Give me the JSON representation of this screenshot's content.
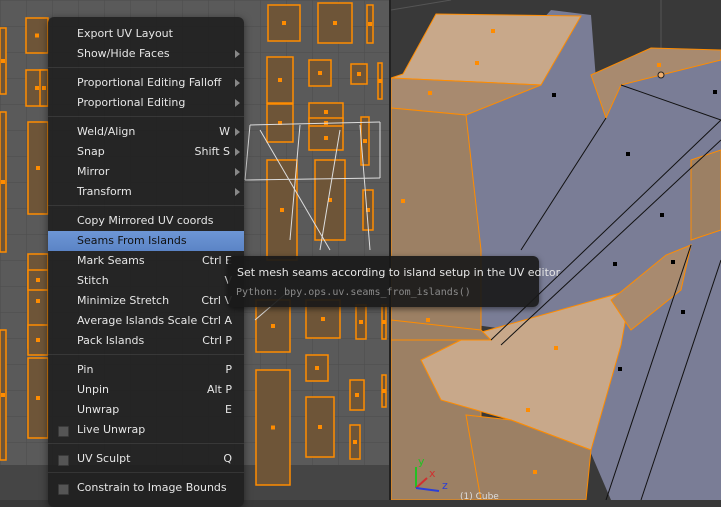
{
  "uv_menu": {
    "items": [
      {
        "label": "Export UV Layout",
        "shortcut": "",
        "submenu": false
      },
      {
        "label": "Show/Hide Faces",
        "shortcut": "",
        "submenu": true
      },
      {
        "label": "Proportional Editing Falloff",
        "shortcut": "",
        "submenu": true
      },
      {
        "label": "Proportional Editing",
        "shortcut": "",
        "submenu": true
      },
      {
        "label": "Weld/Align",
        "shortcut": "W",
        "submenu": true
      },
      {
        "label": "Snap",
        "shortcut": "Shift S",
        "submenu": true
      },
      {
        "label": "Mirror",
        "shortcut": "",
        "submenu": true
      },
      {
        "label": "Transform",
        "shortcut": "",
        "submenu": true
      },
      {
        "label": "Copy Mirrored UV coords",
        "shortcut": "",
        "submenu": false
      },
      {
        "label": "Seams From Islands",
        "shortcut": "",
        "submenu": false,
        "highlighted": true
      },
      {
        "label": "Mark Seams",
        "shortcut": "Ctrl E",
        "submenu": false
      },
      {
        "label": "Stitch",
        "shortcut": "V",
        "submenu": false
      },
      {
        "label": "Minimize Stretch",
        "shortcut": "Ctrl V",
        "submenu": false
      },
      {
        "label": "Average Islands Scale",
        "shortcut": "Ctrl A",
        "submenu": false
      },
      {
        "label": "Pack Islands",
        "shortcut": "Ctrl P",
        "submenu": false
      },
      {
        "label": "Pin",
        "shortcut": "P",
        "submenu": false
      },
      {
        "label": "Unpin",
        "shortcut": "Alt P",
        "submenu": false
      },
      {
        "label": "Unwrap",
        "shortcut": "E",
        "submenu": false
      },
      {
        "label": "Live Unwrap",
        "shortcut": "",
        "checkbox": true,
        "checked": false
      },
      {
        "label": "UV Sculpt",
        "shortcut": "Q",
        "checkbox": true,
        "checked": false
      },
      {
        "label": "Constrain to Image Bounds",
        "shortcut": "",
        "checkbox": true,
        "checked": false
      }
    ]
  },
  "tooltip": {
    "description": "Set mesh seams according to island setup in the UV editor",
    "python": "Python: bpy.ops.uv.seams_from_islands()"
  },
  "viewport": {
    "axes": {
      "x": "x",
      "y": "y",
      "z": "z"
    },
    "object_info": "(1) Cube"
  },
  "colors": {
    "highlight": "#5b84c6",
    "selection_orange": "#ff8c00",
    "face_selected": "#c8a88a",
    "face_unselected": "#7a7d96"
  }
}
